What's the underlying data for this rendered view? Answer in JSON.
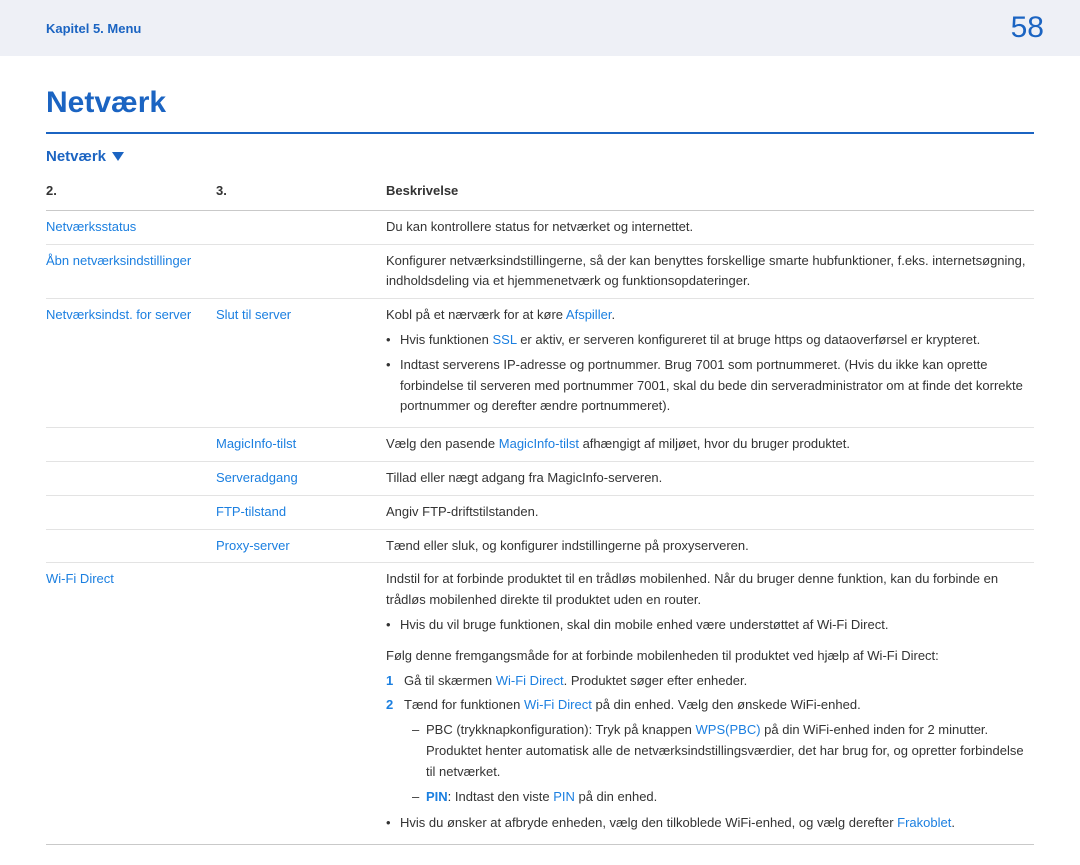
{
  "header": {
    "breadcrumb": "Kapitel 5. Menu",
    "page_number": "58"
  },
  "section": {
    "title": "Netværk",
    "subheading": "Netværk"
  },
  "table": {
    "head": {
      "col2": "2.",
      "col3": "3.",
      "desc": "Beskrivelse"
    },
    "rows": {
      "status": {
        "c2": "Netværksstatus",
        "desc": "Du kan kontrollere status for netværket og internettet."
      },
      "open_settings": {
        "c2": "Åbn netværksindstillinger",
        "desc": "Konfigurer netværksindstillingerne, så der kan benyttes forskellige smarte hubfunktioner, f.eks. internetsøgning, indholdsdeling via et hjemmenetværk og funktionsopdateringer."
      },
      "server_settings": {
        "c2": "Netværksindst. for server",
        "connect": {
          "c3": "Slut til server",
          "desc_prefix": "Kobl på et nærværk for at køre ",
          "desc_link": "Afspiller",
          "desc_suffix": ".",
          "b1_prefix": "Hvis funktionen ",
          "b1_link": "SSL",
          "b1_suffix": " er aktiv, er serveren konfigureret til at bruge https og dataoverførsel er krypteret.",
          "b2": "Indtast serverens IP-adresse og portnummer. Brug 7001 som portnummeret. (Hvis du ikke kan oprette forbindelse til serveren med portnummer 7001, skal du bede din serveradministrator om at finde det korrekte portnummer og derefter ændre portnummeret)."
        },
        "magicinfo": {
          "c3": "MagicInfo-tilst",
          "desc_prefix": "Vælg den pasende ",
          "desc_link": "MagicInfo-tilst",
          "desc_suffix": " afhængigt af miljøet, hvor du bruger produktet."
        },
        "server_access": {
          "c3": "Serveradgang",
          "desc": "Tillad eller nægt adgang fra MagicInfo-serveren."
        },
        "ftp": {
          "c3": "FTP-tilstand",
          "desc": "Angiv FTP-driftstilstanden."
        },
        "proxy": {
          "c3": "Proxy-server",
          "desc": "Tænd eller sluk, og konfigurer indstillingerne på proxyserveren."
        }
      },
      "wifi_direct": {
        "c2": "Wi-Fi Direct",
        "p1": "Indstil for at forbinde produktet til en trådløs mobilenhed. Når du bruger denne funktion, kan du forbinde en trådløs mobilenhed direkte til produktet uden en router.",
        "b1": "Hvis du vil bruge funktionen, skal din mobile enhed være understøttet af Wi-Fi Direct.",
        "p2": "Følg denne fremgangsmåde for at forbinde mobilenheden til produktet ved hjælp af Wi-Fi Direct:",
        "step1_prefix": "Gå til skærmen ",
        "step1_link": "Wi-Fi Direct",
        "step1_suffix": ". Produktet søger efter enheder.",
        "step2_prefix": "Tænd for funktionen ",
        "step2_link": "Wi-Fi Direct",
        "step2_suffix": " på din enhed. Vælg den ønskede WiFi-enhed.",
        "d1_prefix": "PBC (trykknapkonfiguration): Tryk på knappen ",
        "d1_link": "WPS(PBC)",
        "d1_suffix": " på din WiFi-enhed inden for 2 minutter. Produktet henter automatisk alle de netværksindstillingsværdier, det har brug for, og opretter forbindelse til netværket.",
        "d2_label": "PIN",
        "d2_prefix": ": Indtast den viste ",
        "d2_link": "PIN",
        "d2_suffix": " på din enhed.",
        "b_last_prefix": "Hvis du ønsker at afbryde enheden, vælg den tilkoblede WiFi-enhed, og vælg derefter ",
        "b_last_link": "Frakoblet",
        "b_last_suffix": "."
      }
    }
  }
}
